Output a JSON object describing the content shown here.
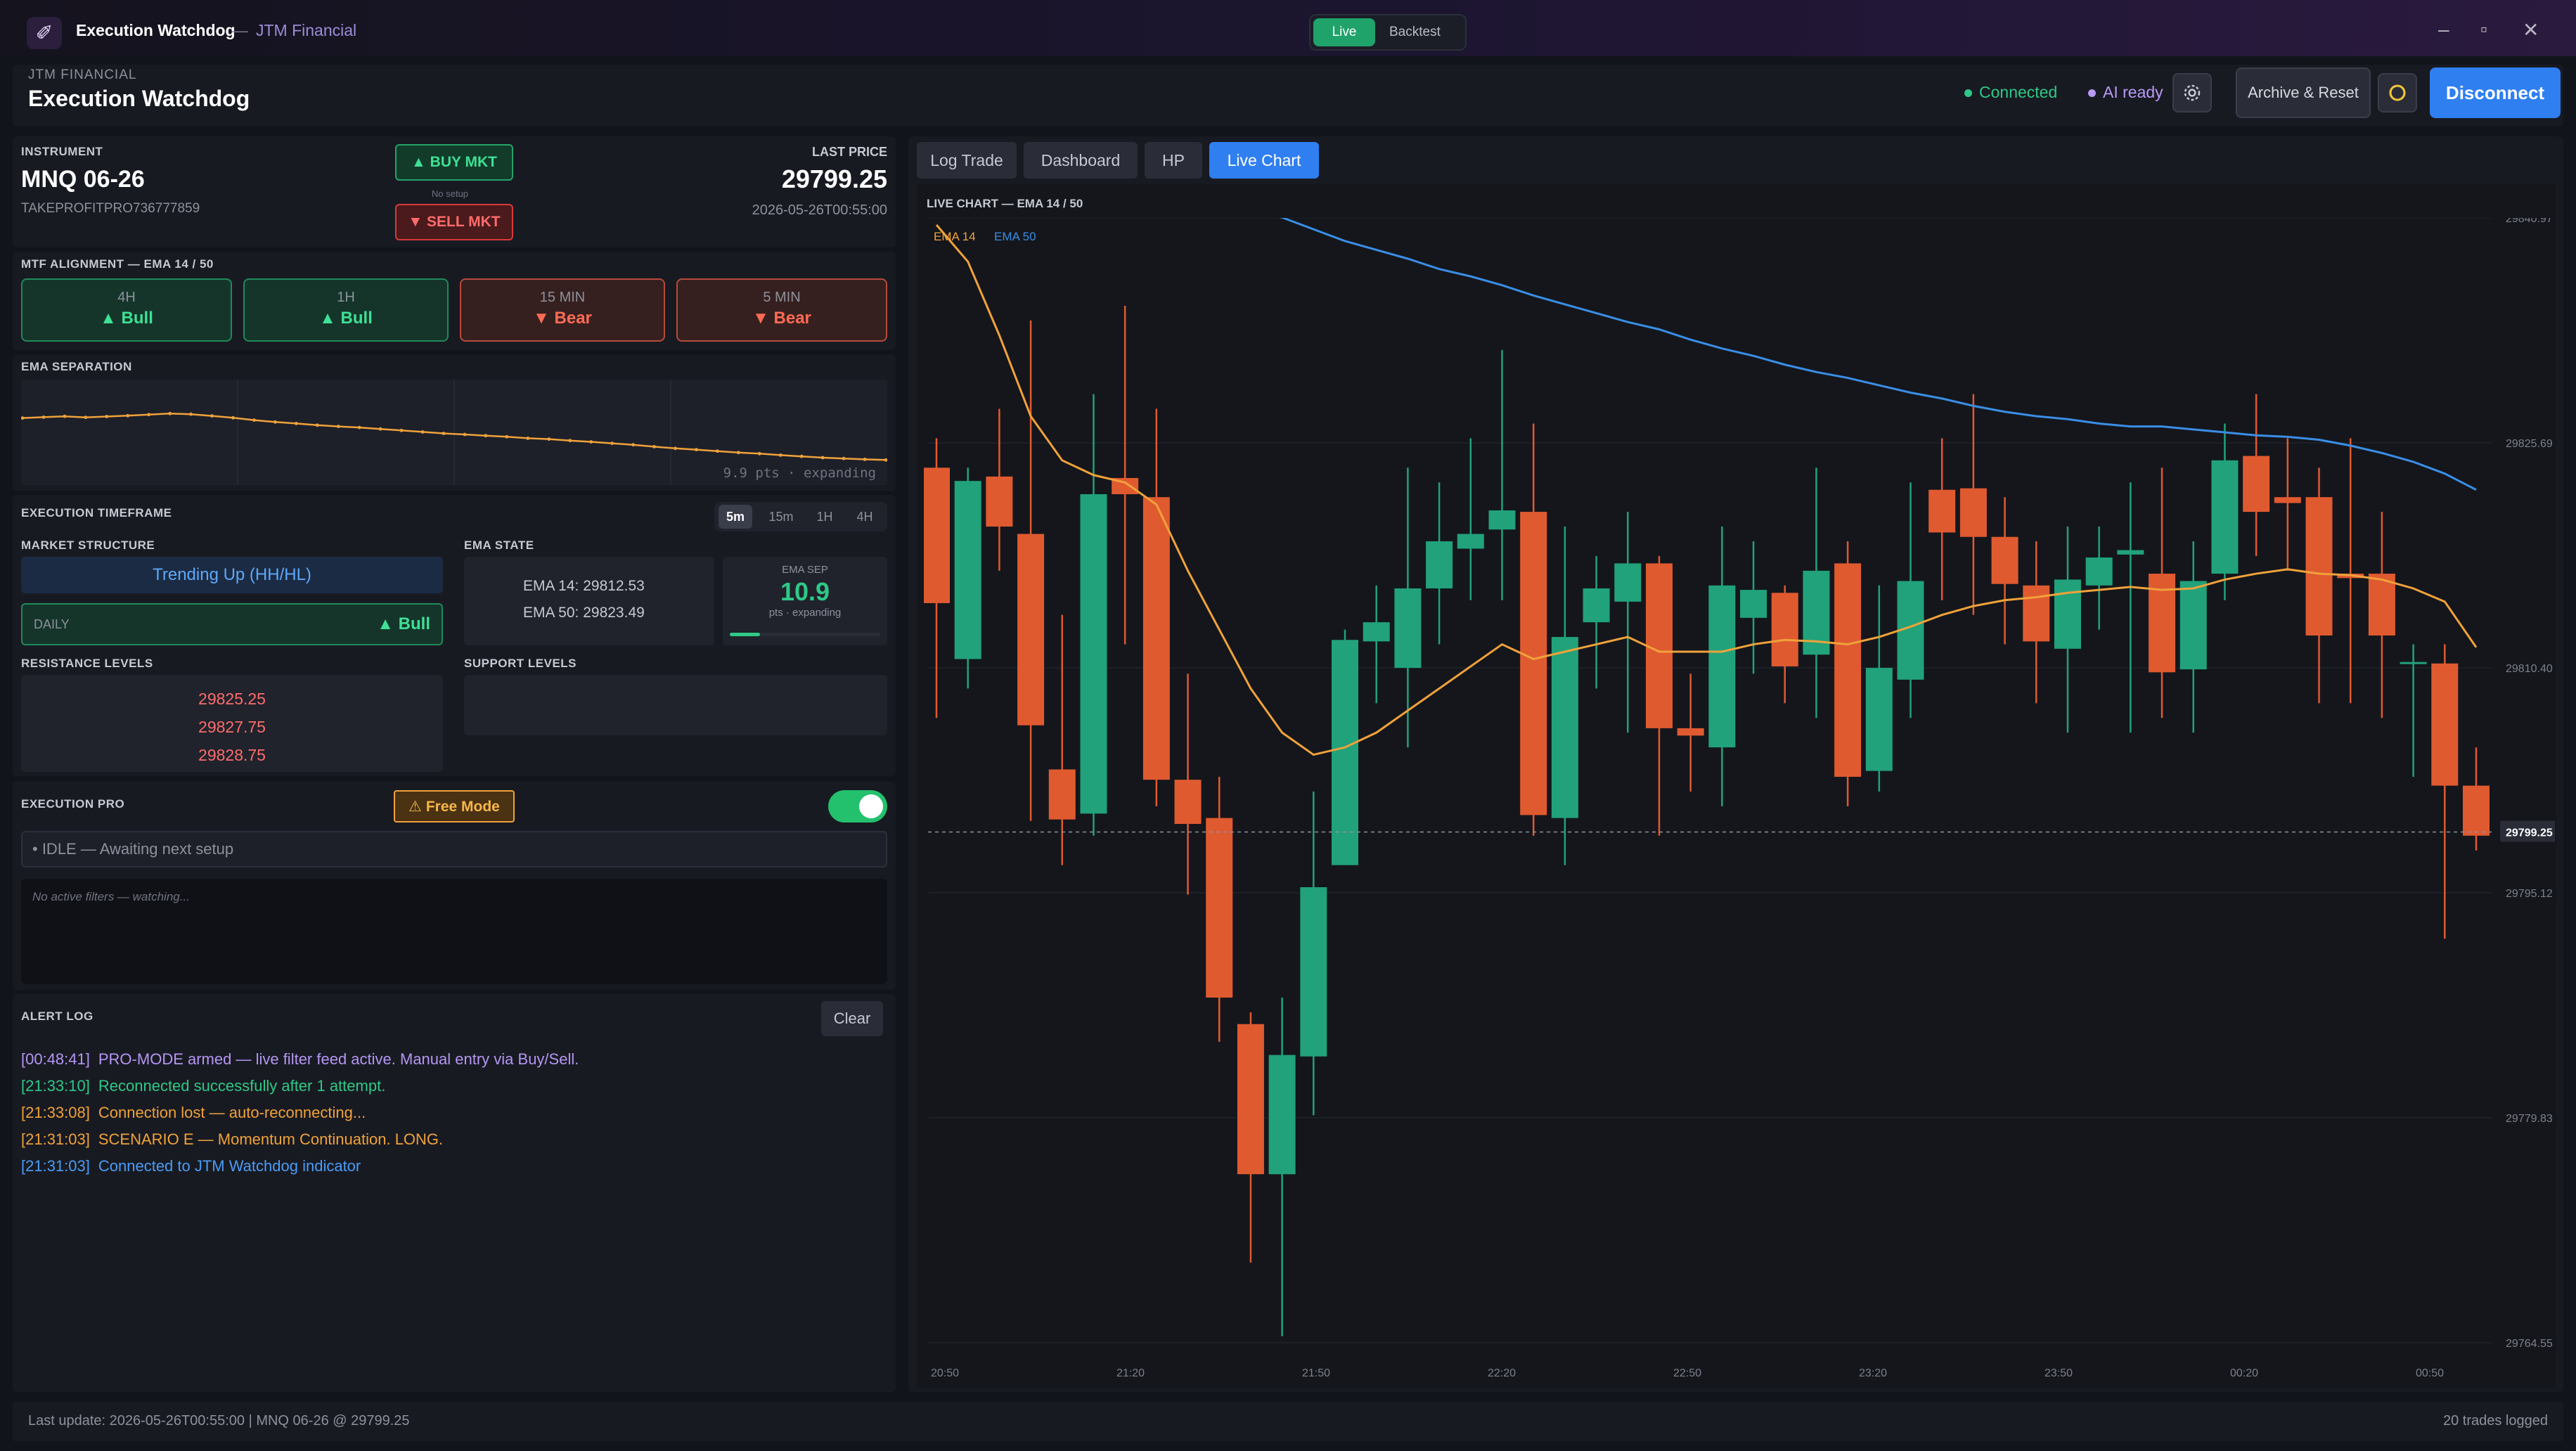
{
  "app": {
    "title": "Execution Watchdog",
    "separator": "—",
    "company": "JTM Financial"
  },
  "mode_switch": {
    "live": "Live",
    "backtest": "Backtest"
  },
  "window": {
    "minimize": "–",
    "maximize": "▫",
    "close": "✕"
  },
  "header": {
    "company": "JTM FINANCIAL",
    "title": "Execution Watchdog",
    "connected": "Connected",
    "ai": "AI ready",
    "archive": "Archive & Reset",
    "disconnect": "Disconnect"
  },
  "instrument": {
    "label": "INSTRUMENT",
    "symbol": "MNQ 06-26",
    "account": "TAKEPROFITPRO736777859",
    "buy": "▲ BUY MKT",
    "no_setup": "No setup",
    "sell": "▼ SELL MKT",
    "last_price_label": "LAST PRICE",
    "last_price": "29799.25",
    "timestamp": "2026-05-26T00:55:00"
  },
  "mtf": {
    "label": "MTF ALIGNMENT — EMA 14 / 50",
    "cards": [
      {
        "tf": "4H",
        "dir": "▲ Bull",
        "state": "bull"
      },
      {
        "tf": "1H",
        "dir": "▲ Bull",
        "state": "bull"
      },
      {
        "tf": "15 MIN",
        "dir": "▼ Bear",
        "state": "bear"
      },
      {
        "tf": "5 MIN",
        "dir": "▼ Bear",
        "state": "bear"
      }
    ]
  },
  "ema_sep": {
    "label": "EMA SEPARATION",
    "caption": "9.9 pts · expanding",
    "values": [
      29.8,
      30.2,
      30.6,
      30.1,
      30.5,
      30.9,
      31.4,
      31.9,
      31.6,
      30.8,
      29.9,
      28.8,
      27.9,
      27.2,
      26.4,
      25.8,
      25.3,
      24.6,
      23.9,
      23.2,
      22.5,
      22.0,
      21.4,
      20.9,
      20.2,
      19.8,
      19.1,
      18.5,
      17.8,
      17.1,
      16.2,
      15.4,
      14.8,
      14.1,
      13.4,
      12.9,
      12.2,
      11.6,
      11.0,
      10.6,
      10.2,
      9.9
    ]
  },
  "exec_tf": {
    "label": "EXECUTION TIMEFRAME",
    "options": [
      "5m",
      "15m",
      "1H",
      "4H"
    ],
    "selected": "5m",
    "market_structure_label": "MARKET STRUCTURE",
    "market_structure": "Trending Up (HH/HL)",
    "daily_label": "DAILY",
    "daily_dir": "▲ Bull",
    "ema_state_label": "EMA STATE",
    "ema14": "EMA 14:  29812.53",
    "ema50": "EMA 50:  29823.49",
    "ema_sep_label": "EMA SEP",
    "ema_sep_value": "10.9",
    "ema_sep_caption": "pts · expanding",
    "ema_sep_level": 0.2,
    "resistance_label": "RESISTANCE LEVELS",
    "resistance": [
      "29825.25",
      "29827.75",
      "29828.75"
    ],
    "support_label": "SUPPORT LEVELS"
  },
  "exec_pro": {
    "label": "EXECUTION PRO",
    "free_mode": "⚠ Free Mode",
    "toggle_on": true,
    "status": "• IDLE — Awaiting next setup",
    "filters": "No active filters — watching..."
  },
  "alert_log": {
    "label": "ALERT LOG",
    "clear": "Clear",
    "entries": [
      {
        "ts": "[00:48:41]",
        "msg": "PRO-MODE armed — live filter feed active. Manual entry via Buy/Sell.",
        "color": "#b596f2"
      },
      {
        "ts": "[21:33:10]",
        "msg": "Reconnected successfully after 1 attempt.",
        "color": "#2ec986"
      },
      {
        "ts": "[21:33:08]",
        "msg": "Connection lost — auto-reconnecting...",
        "color": "#f0a23a"
      },
      {
        "ts": "[21:31:03]",
        "msg": "SCENARIO E — Momentum Continuation. LONG.",
        "color": "#f0a23a"
      },
      {
        "ts": "[21:31:03]",
        "msg": "Connected to JTM Watchdog indicator",
        "color": "#4a9cf5"
      }
    ]
  },
  "tabs": [
    {
      "label": "Log Trade",
      "active": false
    },
    {
      "label": "Dashboard",
      "active": false
    },
    {
      "label": "HP",
      "active": false
    },
    {
      "label": "Live Chart",
      "active": true
    }
  ],
  "footer": {
    "left": "Last update: 2026-05-26T00:55:00 | MNQ 06-26 @ 29799.25",
    "right": "20 trades logged"
  },
  "colors": {
    "up": "#21a27a",
    "down": "#e05a30",
    "ema14": "#f0a23a",
    "ema50": "#3a8ee6"
  },
  "chart_data": {
    "type": "candlestick",
    "title": "LIVE CHART — EMA 14 / 50",
    "legend": [
      "EMA 14",
      "EMA 50"
    ],
    "y_ticks": [
      "29840.97",
      "29825.69",
      "29810.40",
      "29795.12",
      "29779.83",
      "29764.55"
    ],
    "y_tick_values": [
      29840.97,
      29825.69,
      29810.4,
      29795.12,
      29779.83,
      29764.55
    ],
    "ylim": [
      29764.55,
      29840.97
    ],
    "x_ticks": [
      "20:50",
      "21:20",
      "21:50",
      "22:20",
      "22:50",
      "23:20",
      "23:50",
      "00:20",
      "00:50"
    ],
    "last_price": 29799.25,
    "candles": [
      {
        "o": 29824.0,
        "c": 29814.8,
        "h": 29826.0,
        "l": 29807.0
      },
      {
        "o": 29811.0,
        "c": 29823.1,
        "h": 29824.0,
        "l": 29809.0
      },
      {
        "o": 29823.4,
        "c": 29820.0,
        "h": 29828.0,
        "l": 29817.0
      },
      {
        "o": 29819.5,
        "c": 29806.5,
        "h": 29834.0,
        "l": 29800.0
      },
      {
        "o": 29803.5,
        "c": 29800.1,
        "h": 29814.0,
        "l": 29797.0
      },
      {
        "o": 29800.5,
        "c": 29822.2,
        "h": 29829.0,
        "l": 29799.0
      },
      {
        "o": 29823.3,
        "c": 29822.2,
        "h": 29835.0,
        "l": 29812.0
      },
      {
        "o": 29822.0,
        "c": 29802.8,
        "h": 29828.0,
        "l": 29801.0
      },
      {
        "o": 29802.8,
        "c": 29799.8,
        "h": 29810.0,
        "l": 29795.0
      },
      {
        "o": 29800.2,
        "c": 29788.0,
        "h": 29803.0,
        "l": 29785.0
      },
      {
        "o": 29786.2,
        "c": 29776.0,
        "h": 29787.0,
        "l": 29770.0
      },
      {
        "o": 29776.0,
        "c": 29784.1,
        "h": 29788.0,
        "l": 29765.0
      },
      {
        "o": 29784.0,
        "c": 29795.5,
        "h": 29802.0,
        "l": 29780.0
      },
      {
        "o": 29797.0,
        "c": 29812.3,
        "h": 29813.0,
        "l": 29797.0
      },
      {
        "o": 29812.2,
        "c": 29813.5,
        "h": 29816.0,
        "l": 29808.0
      },
      {
        "o": 29810.4,
        "c": 29815.8,
        "h": 29824.0,
        "l": 29805.0
      },
      {
        "o": 29815.8,
        "c": 29819.0,
        "h": 29823.0,
        "l": 29812.0
      },
      {
        "o": 29818.5,
        "c": 29819.5,
        "h": 29826.0,
        "l": 29815.0
      },
      {
        "o": 29819.8,
        "c": 29821.1,
        "h": 29832.0,
        "l": 29815.0
      },
      {
        "o": 29821.0,
        "c": 29800.4,
        "h": 29827.0,
        "l": 29799.0
      },
      {
        "o": 29800.2,
        "c": 29812.5,
        "h": 29820.0,
        "l": 29797.0
      },
      {
        "o": 29813.5,
        "c": 29815.8,
        "h": 29818.0,
        "l": 29809.0
      },
      {
        "o": 29814.9,
        "c": 29817.5,
        "h": 29821.0,
        "l": 29806.0
      },
      {
        "o": 29817.5,
        "c": 29806.3,
        "h": 29818.0,
        "l": 29799.0
      },
      {
        "o": 29806.3,
        "c": 29805.8,
        "h": 29810.0,
        "l": 29802.0
      },
      {
        "o": 29805.0,
        "c": 29816.0,
        "h": 29820.0,
        "l": 29801.0
      },
      {
        "o": 29813.8,
        "c": 29815.7,
        "h": 29819.0,
        "l": 29810.0
      },
      {
        "o": 29815.5,
        "c": 29810.5,
        "h": 29816.0,
        "l": 29808.0
      },
      {
        "o": 29811.3,
        "c": 29817.0,
        "h": 29824.0,
        "l": 29807.0
      },
      {
        "o": 29817.5,
        "c": 29803.0,
        "h": 29819.0,
        "l": 29801.0
      },
      {
        "o": 29803.4,
        "c": 29810.4,
        "h": 29816.0,
        "l": 29802.0
      },
      {
        "o": 29809.6,
        "c": 29816.3,
        "h": 29823.0,
        "l": 29807.0
      },
      {
        "o": 29822.5,
        "c": 29819.6,
        "h": 29826.0,
        "l": 29815.0
      },
      {
        "o": 29822.6,
        "c": 29819.3,
        "h": 29829.0,
        "l": 29814.0
      },
      {
        "o": 29819.3,
        "c": 29816.1,
        "h": 29822.0,
        "l": 29812.0
      },
      {
        "o": 29816.0,
        "c": 29812.2,
        "h": 29819.0,
        "l": 29808.0
      },
      {
        "o": 29811.7,
        "c": 29816.4,
        "h": 29820.0,
        "l": 29806.0
      },
      {
        "o": 29816.0,
        "c": 29817.9,
        "h": 29820.0,
        "l": 29813.0
      },
      {
        "o": 29818.1,
        "c": 29818.4,
        "h": 29823.0,
        "l": 29806.0
      },
      {
        "o": 29816.8,
        "c": 29810.1,
        "h": 29824.0,
        "l": 29807.0
      },
      {
        "o": 29810.3,
        "c": 29816.3,
        "h": 29819.0,
        "l": 29806.0
      },
      {
        "o": 29816.8,
        "c": 29824.5,
        "h": 29827.0,
        "l": 29815.0
      },
      {
        "o": 29824.8,
        "c": 29821.0,
        "h": 29829.0,
        "l": 29818.0
      },
      {
        "o": 29822.0,
        "c": 29821.6,
        "h": 29826.0,
        "l": 29817.0
      },
      {
        "o": 29822.0,
        "c": 29812.6,
        "h": 29824.0,
        "l": 29808.0
      },
      {
        "o": 29816.8,
        "c": 29816.5,
        "h": 29826.0,
        "l": 29808.0
      },
      {
        "o": 29816.8,
        "c": 29812.6,
        "h": 29821.0,
        "l": 29807.0
      },
      {
        "o": 29810.8,
        "c": 29810.8,
        "h": 29812.0,
        "l": 29803.0
      },
      {
        "o": 29810.7,
        "c": 29802.4,
        "h": 29812.0,
        "l": 29792.0
      },
      {
        "o": 29802.4,
        "c": 29799.0,
        "h": 29805.0,
        "l": 29798.0
      }
    ],
    "ema14": [
      29840.5,
      29838.0,
      29833.0,
      29827.5,
      29824.5,
      29823.5,
      29823.0,
      29821.5,
      29817.0,
      29813.0,
      29809.0,
      29806.0,
      29804.5,
      29805.0,
      29806.0,
      29807.5,
      29809.0,
      29810.5,
      29812.0,
      29811.0,
      29811.5,
      29812.0,
      29812.5,
      29811.5,
      29811.5,
      29811.5,
      29812.0,
      29812.3,
      29812.2,
      29812.0,
      29812.5,
      29813.2,
      29814.0,
      29814.6,
      29815.0,
      29815.2,
      29815.5,
      29815.7,
      29815.9,
      29815.7,
      29815.8,
      29816.4,
      29816.8,
      29817.1,
      29816.8,
      29816.7,
      29816.4,
      29815.8,
      29814.9,
      29811.8
    ],
    "ema50": [
      29852.0,
      29851.0,
      29850.0,
      29849.0,
      29848.0,
      29847.0,
      29846.0,
      29845.0,
      29844.0,
      29843.0,
      29842.0,
      29841.0,
      29840.2,
      29839.4,
      29838.8,
      29838.2,
      29837.5,
      29837.0,
      29836.4,
      29835.7,
      29835.1,
      29834.5,
      29833.9,
      29833.4,
      29832.7,
      29832.1,
      29831.6,
      29831.0,
      29830.5,
      29830.1,
      29829.6,
      29829.1,
      29828.7,
      29828.2,
      29827.8,
      29827.5,
      29827.3,
      29827.0,
      29826.8,
      29826.8,
      29826.6,
      29826.4,
      29826.2,
      29826.1,
      29825.9,
      29825.5,
      29825.0,
      29824.4,
      29823.6,
      29822.5
    ]
  }
}
